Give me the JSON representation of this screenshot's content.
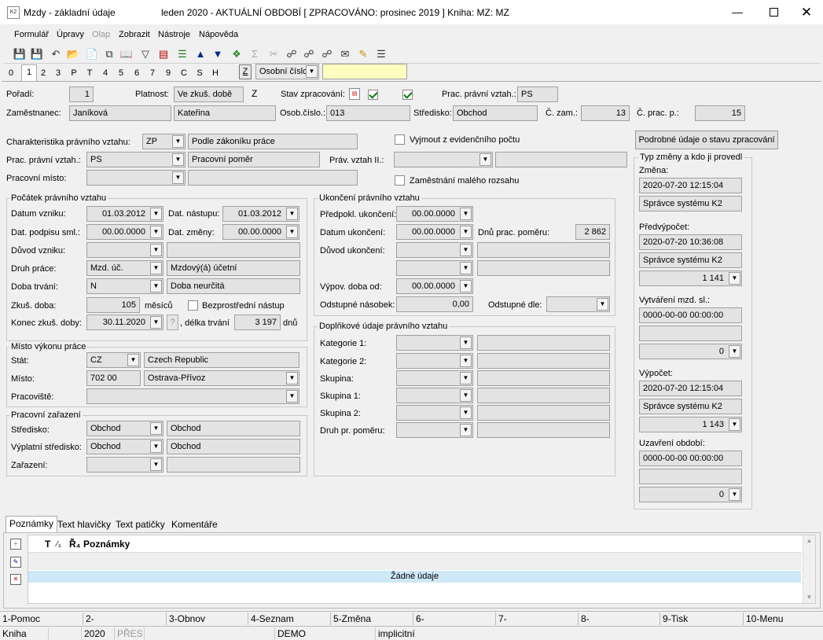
{
  "window": {
    "app_title": "Mzdy - základní údaje",
    "period_info": "leden 2020 - AKTUÁLNÍ OBDOBÍ [ ZPRACOVÁNO: prosinec 2019 ] Kniha: MZ: MZ"
  },
  "menu": [
    "Formulář",
    "Úpravy",
    "Olap",
    "Zobrazit",
    "Nástroje",
    "Nápověda"
  ],
  "tabs": [
    "0",
    "1",
    "2",
    "3",
    "P",
    "T",
    "4",
    "5",
    "6",
    "7",
    "9",
    "C",
    "S",
    "H"
  ],
  "search": {
    "z_label": "Z",
    "sort_value": "Osobní číslo",
    "search_value": ""
  },
  "header": {
    "poradi_label": "Pořadí:",
    "poradi_value": "1",
    "platnost_label": "Platnost:",
    "platnost_value": "Ve zkuš. době",
    "platnost_code": "Z",
    "stav_label": "Stav zpracování:",
    "prac_vztah_label": "Prac. právní vztah.:",
    "prac_vztah_value": "PS",
    "zam_label": "Zaměstnanec:",
    "prijmeni": "Janíková",
    "jmeno": "Kateřina",
    "osob_label": "Osob.číslo.:",
    "osob_value": "013",
    "stredisko_label": "Středisko:",
    "stredisko_value": "Obchod",
    "czam_label": "Č. zam.:",
    "czam_value": "13",
    "cprac_label": "Č. prac. p.:",
    "cprac_value": "15"
  },
  "upper": {
    "char_label": "Charakteristika právního vztahu:",
    "char_code": "ZP",
    "char_text": "Podle zákoníku práce",
    "prac_label": "Prac. právní vztah.:",
    "prac_code": "PS",
    "prac_text": "Pracovní poměr",
    "misto_label": "Pracovní místo:",
    "misto_code": "",
    "misto_text": "",
    "vyjmout_label": "Vyjmout z evidenčního počtu",
    "prav2_label": "Práv. vztah II.:",
    "prav2_code": "",
    "prav2_text": "",
    "maly_label": "Zaměstnání malého rozsahu",
    "detail_button": "Podrobné údaje o stavu zpracování"
  },
  "pocatek": {
    "title": "Počátek právního vztahu",
    "vznik_label": "Datum vzniku:",
    "vznik_value": "01.03.2012",
    "nastup_label": "Dat. nástupu:",
    "nastup_value": "01.03.2012",
    "podpis_label": "Dat. podpisu sml.:",
    "podpis_value": "00.00.0000",
    "zmena_label": "Dat. změny:",
    "zmena_value": "00.00.0000",
    "duvod_label": "Důvod vzniku:",
    "duvod_code": "",
    "duvod_text": "",
    "druh_label": "Druh práce:",
    "druh_code": "Mzd. úč.",
    "druh_text": "Mzdový(á) účetní",
    "doba_label": "Doba trvání:",
    "doba_code": "N",
    "doba_text": "Doba neurčitá",
    "zkus_label": "Zkuš. doba:",
    "zkus_value": "105",
    "zkus_unit": "měsíců",
    "bezpr_label": "Bezprostřední nástup",
    "konec_label": "Konec zkuš. doby:",
    "konec_value": "30.11.2020",
    "q_button": "?",
    "delka_label": ", délka trvání",
    "delka_value": "3 197",
    "delka_unit": "dnů"
  },
  "misto": {
    "title": "Místo výkonu práce",
    "stat_label": "Stát:",
    "stat_code": "CZ",
    "stat_text": "Czech Republic",
    "misto_label": "Místo:",
    "misto_code": "702 00",
    "misto_text": "Ostrava-Přívoz",
    "pracoviste_label": "Pracoviště:",
    "pracoviste_value": ""
  },
  "zarazeni": {
    "title": "Pracovní zařazení",
    "str_label": "Středisko:",
    "str_code": "Obchod",
    "str_text": "Obchod",
    "vypl_label": "Výplatní středisko:",
    "vypl_code": "Obchod",
    "vypl_text": "Obchod",
    "zar_label": "Zařazení:",
    "zar_code": "",
    "zar_text": ""
  },
  "ukonceni": {
    "title": "Ukončení právního vztahu",
    "predp_label": "Předpokl. ukončení:",
    "predp_value": "00.00.0000",
    "datum_label": "Datum ukončení:",
    "datum_value": "00.00.0000",
    "dnu_label": "Dnů prac. poměru:",
    "dnu_value": "2 862",
    "duvod_label": "Důvod ukončení:",
    "vypov_label": "Výpov. doba od:",
    "vypov_value": "00.00.0000",
    "odst_label": "Odstupné násobek:",
    "odst_value": "0,00",
    "odst_dle_label": "Odstupné dle:",
    "odst_dle_value": ""
  },
  "doplnkove": {
    "title": "Doplňkové údaje právního vztahu",
    "rows": [
      "Kategorie 1:",
      "Kategorie 2:",
      "Skupina:",
      "Skupina 1:",
      "Skupina 2:",
      "Druh pr. poměru:"
    ]
  },
  "right": {
    "title": "Typ změny a kdo ji provedl",
    "zmena_label": "Změna:",
    "zmena_date": "2020-07-20 12:15:04",
    "zmena_user": "Správce systému K2",
    "predv_label": "Předvýpočet:",
    "predv_date": "2020-07-20 10:36:08",
    "predv_user": "Správce systému K2",
    "predv_num": "1 141",
    "vytv_label": "Vytváření mzd. sl.:",
    "vytv_date": "0000-00-00 00:00:00",
    "vytv_user": "",
    "vytv_num": "0",
    "vyp_label": "Výpočet:",
    "vyp_date": "2020-07-20 12:15:04",
    "vyp_user": "Správce systému K2",
    "vyp_num": "1 143",
    "uzav_label": "Uzavření období:",
    "uzav_date": "0000-00-00 00:00:00",
    "uzav_user": "",
    "uzav_num": "0"
  },
  "bottom_tabs": [
    "Poznámky",
    "Text hlavičky",
    "Text patičky",
    "Komentáře"
  ],
  "notes": {
    "col_t": "T",
    "col_3": "⁄₃",
    "col_r": "Ř̃₄",
    "col_title": "Poznámky",
    "empty": "Žádné údaje"
  },
  "fnkeys": [
    "1-Pomoc",
    "2-",
    "3-Obnov",
    "4-Seznam",
    "5-Změna",
    "6-",
    "7-",
    "8-",
    "9-Tisk",
    "10-Menu"
  ],
  "status": [
    "Kniha",
    "",
    "2020",
    "PŘES",
    "",
    "DEMO",
    "implicitní"
  ]
}
